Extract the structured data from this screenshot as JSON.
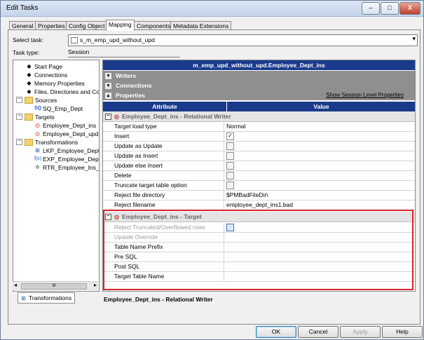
{
  "window": {
    "title": "Edit Tasks",
    "controls": {
      "minimize": "–",
      "maximize": "□",
      "close": "X"
    }
  },
  "tabs": [
    "General",
    "Properties",
    "Config Object",
    "Mapping",
    "Components",
    "Metadata Extensions"
  ],
  "active_tab": "Mapping",
  "select_task": {
    "label": "Select task:",
    "value": "s_m_emp_upd_without_upd"
  },
  "task_type": {
    "label": "Task type:",
    "value": "Session"
  },
  "tree": {
    "top_items": [
      "Start Page",
      "Connections",
      "Memory Properties",
      "Files, Directories and Com"
    ],
    "sources": {
      "label": "Sources",
      "children": [
        "SQ_Emp_Dept"
      ]
    },
    "targets": {
      "label": "Targets",
      "children": [
        "Employee_Dept_ins",
        "Employee_Dept_upd"
      ]
    },
    "transformations": {
      "label": "Transformations",
      "children": [
        "LKP_Employee_Dept",
        "EXP_Employee_Dept",
        "RTR_Employee_Ins_U"
      ]
    }
  },
  "bottom_tab": "Transformations",
  "object_header": "m_emp_upd_without_upd.Employee_Dept_ins",
  "sections": {
    "writers": "Writers",
    "connections": "Connections",
    "properties": "Properties",
    "show_session_link": "Show Session Level Properties"
  },
  "columns": {
    "attribute": "Attribute",
    "value": "Value"
  },
  "group_writer": "Employee_Dept_ins - Relational Writer",
  "writer_rows": [
    {
      "attribute": "Target load type",
      "value": "Normal"
    },
    {
      "attribute": "Insert",
      "checked": true
    },
    {
      "attribute": "Update as Update",
      "checked": false
    },
    {
      "attribute": "Update as Insert",
      "checked": false
    },
    {
      "attribute": "Update else Insert",
      "checked": false
    },
    {
      "attribute": "Delete",
      "checked": false
    },
    {
      "attribute": "Truncate target table option",
      "checked": false
    },
    {
      "attribute": "Reject file directory",
      "value": "$PMBadFileDir\\"
    },
    {
      "attribute": "Reject filename",
      "value": "employee_dept_ins1.bad"
    }
  ],
  "group_target": "Employee_Dept_ins - Target",
  "target_rows": [
    {
      "attribute": "Reject Truncated/Overflowed rows",
      "checked": false
    },
    {
      "attribute": "Update Override",
      "value": ""
    },
    {
      "attribute": "Table Name Prefix",
      "value": ""
    },
    {
      "attribute": "Pre SQL",
      "value": ""
    },
    {
      "attribute": "Post SQL",
      "value": ""
    },
    {
      "attribute": "Target Table Name",
      "value": ""
    }
  ],
  "description": "Employee_Dept_ins - Relational Writer",
  "buttons": {
    "ok": "OK",
    "cancel": "Cancel",
    "apply": "Apply",
    "help": "Help"
  },
  "colors": {
    "header_blue": "#1a3b8c",
    "highlight_red": "#d9252b",
    "section_gray": "#8f8f8f"
  }
}
